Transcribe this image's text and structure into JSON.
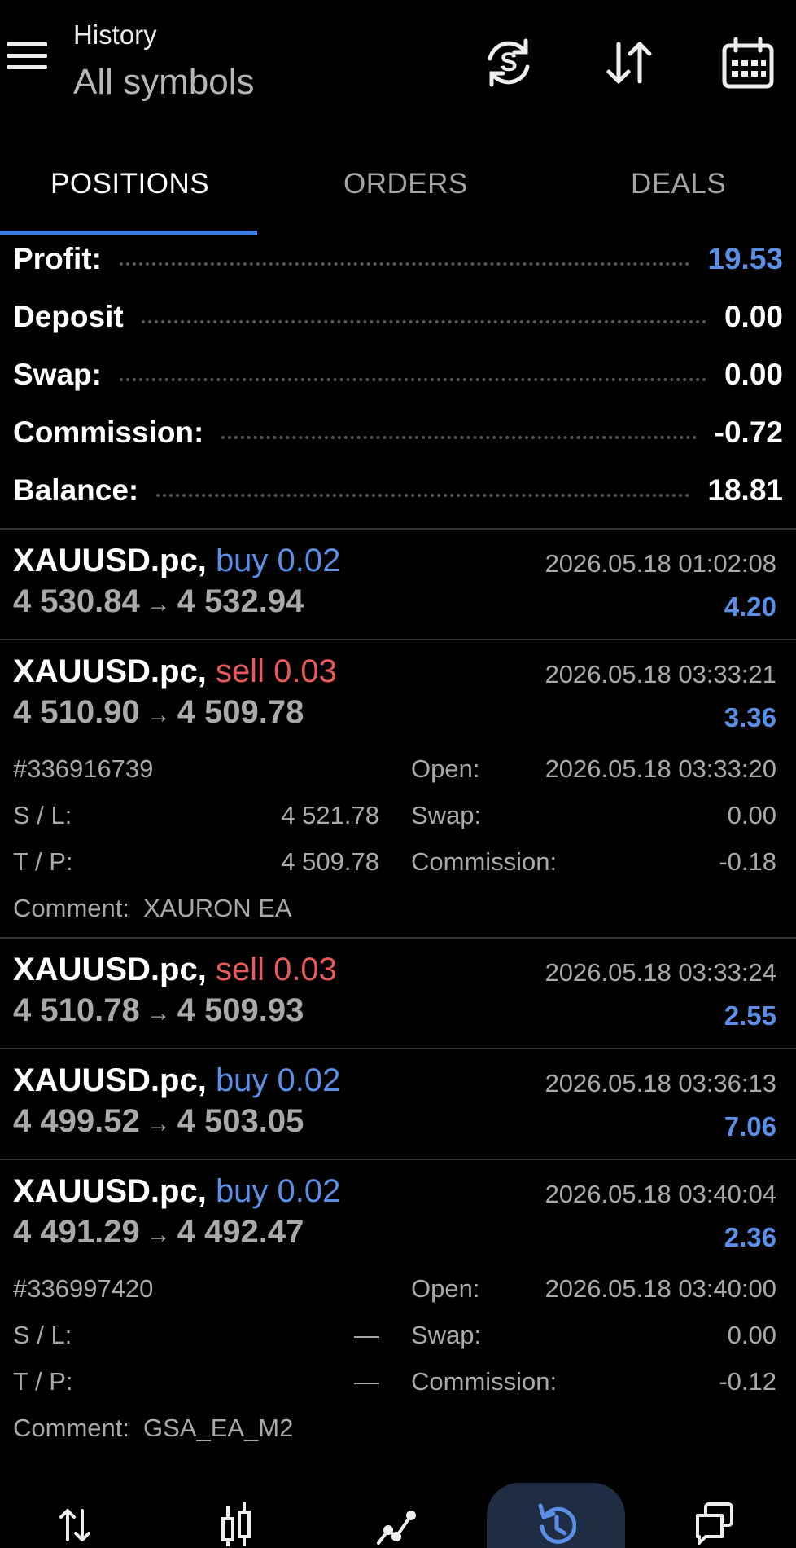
{
  "header": {
    "title": "History",
    "subtitle": "All symbols",
    "icons": [
      "currency-refresh-icon",
      "sort-icon",
      "calendar-icon"
    ]
  },
  "tabs": [
    {
      "label": "POSITIONS",
      "active": true
    },
    {
      "label": "ORDERS",
      "active": false
    },
    {
      "label": "DEALS",
      "active": false
    }
  ],
  "summary": {
    "profit": {
      "label": "Profit:",
      "value": "19.53"
    },
    "deposit": {
      "label": "Deposit",
      "value": "0.00"
    },
    "swap": {
      "label": "Swap:",
      "value": "0.00"
    },
    "commission": {
      "label": "Commission:",
      "value": "-0.72"
    },
    "balance": {
      "label": "Balance:",
      "value": "18.81"
    }
  },
  "labels": {
    "open": "Open:",
    "swap": "Swap:",
    "commission": "Commission:",
    "sl": "S / L:",
    "tp": "T / P:",
    "comment": "Comment:",
    "arrow": "→"
  },
  "positions": [
    {
      "symbol": "XAUUSD.pc,",
      "side": "buy 0.02",
      "open_price": "4 530.84",
      "close_price": "4 532.94",
      "time": "2026.05.18 01:02:08",
      "profit": "4.20"
    },
    {
      "symbol": "XAUUSD.pc,",
      "side": "sell 0.03",
      "open_price": "4 510.90",
      "close_price": "4 509.78",
      "time": "2026.05.18 03:33:21",
      "profit": "3.36",
      "details": {
        "ticket": "#336916739",
        "open_time": "2026.05.18 03:33:20",
        "sl": "4 521.78",
        "tp": "4 509.78",
        "swap": "0.00",
        "commission": "-0.18",
        "comment": "XAURON EA"
      }
    },
    {
      "symbol": "XAUUSD.pc,",
      "side": "sell 0.03",
      "open_price": "4 510.78",
      "close_price": "4 509.93",
      "time": "2026.05.18 03:33:24",
      "profit": "2.55"
    },
    {
      "symbol": "XAUUSD.pc,",
      "side": "buy 0.02",
      "open_price": "4 499.52",
      "close_price": "4 503.05",
      "time": "2026.05.18 03:36:13",
      "profit": "7.06"
    },
    {
      "symbol": "XAUUSD.pc,",
      "side": "buy 0.02",
      "open_price": "4 491.29",
      "close_price": "4 492.47",
      "time": "2026.05.18 03:40:04",
      "profit": "2.36",
      "details": {
        "ticket": "#336997420",
        "open_time": "2026.05.18 03:40:00",
        "sl": "—",
        "tp": "—",
        "swap": "0.00",
        "commission": "-0.12",
        "comment": "GSA_EA_M2"
      }
    }
  ],
  "bottom_nav": [
    {
      "icon": "trade-icon",
      "active": false
    },
    {
      "icon": "chart-bars-icon",
      "active": false
    },
    {
      "icon": "quotes-line-icon",
      "active": false
    },
    {
      "icon": "history-icon",
      "active": true
    },
    {
      "icon": "messages-icon",
      "active": false
    }
  ],
  "colors": {
    "accent": "#3d7ee0",
    "buy": "#5b8fe6",
    "sell": "#e85a5a",
    "background": "#000000"
  }
}
